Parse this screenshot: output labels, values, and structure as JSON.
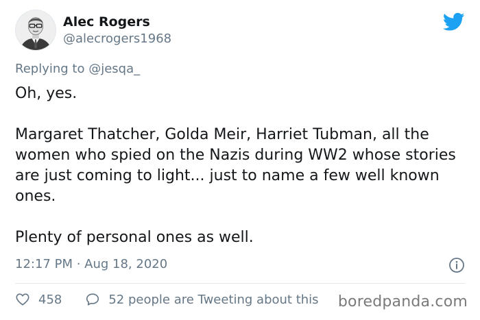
{
  "tweet": {
    "author": {
      "display_name": "Alec Rogers",
      "handle": "@alecrogers1968"
    },
    "reply_to": "Replying to @jesqa_",
    "paragraphs": [
      "Oh, yes.",
      "Margaret Thatcher,  Golda Meir, Harriet Tubman, all the women who spied on the Nazis during WW2 whose stories are just coming to light... just to name a few well known ones.",
      "Plenty of personal ones as well."
    ],
    "timestamp": "12:17 PM · Aug 18, 2020",
    "likes": "458",
    "tweeting_about": "52 people are Tweeting about this"
  },
  "watermark": "boredpanda.com",
  "icons": {
    "brand": "twitter-bird-icon",
    "info": "info-icon",
    "like": "heart-icon",
    "reply": "speech-bubble-icon"
  },
  "colors": {
    "twitter_blue": "#1da1f2",
    "secondary_text": "#657786",
    "primary_text": "#14171a",
    "divider": "#e1e8ed"
  }
}
